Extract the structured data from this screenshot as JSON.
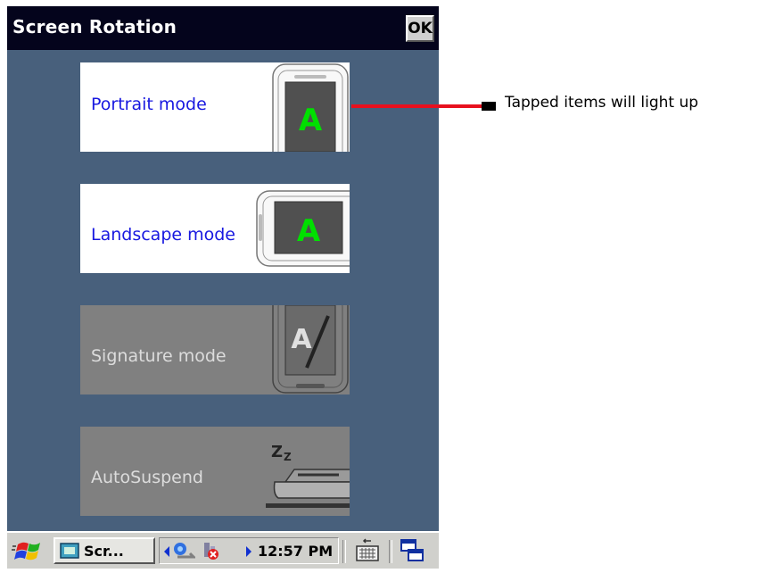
{
  "window": {
    "title": "Screen Rotation",
    "ok_label": "OK"
  },
  "items": [
    {
      "label": "Portrait mode",
      "state": "active",
      "icon": "portrait-device-icon",
      "glyph": "A"
    },
    {
      "label": "Landscape mode",
      "state": "active",
      "icon": "landscape-device-icon",
      "glyph": "A"
    },
    {
      "label": "Signature mode",
      "state": "disabled",
      "icon": "signature-device-icon",
      "glyph": "A"
    },
    {
      "label": "AutoSuspend",
      "state": "disabled",
      "icon": "sleep-icon",
      "glyph": "Z"
    }
  ],
  "taskbar": {
    "task_label": "Scr...",
    "clock": "12:57 PM"
  },
  "annotation": {
    "text": "Tapped items will light up"
  },
  "colors": {
    "background": "#48607c",
    "titlebar": "#04041c",
    "active_item": "#ffffff",
    "active_label": "#1818e0",
    "disabled_item": "#808080",
    "accent_glyph": "#00e000",
    "callout": "#e8101e"
  }
}
